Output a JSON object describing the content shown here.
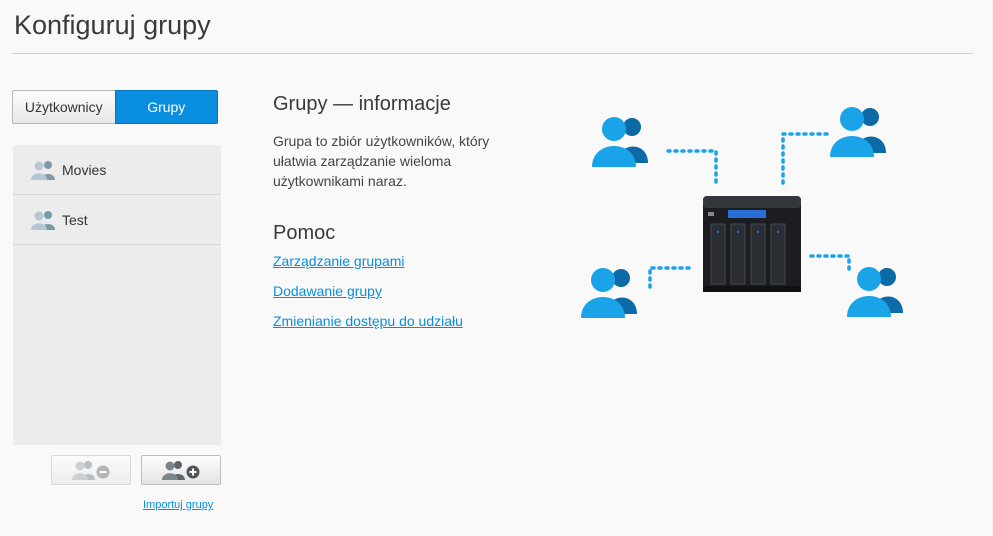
{
  "page": {
    "title": "Konfiguruj grupy"
  },
  "tabs": {
    "users_label": "Użytkownicy",
    "groups_label": "Grupy",
    "active": "Grupy"
  },
  "groups": [
    {
      "name": "Movies"
    },
    {
      "name": "Test"
    }
  ],
  "actions": {
    "import_label": "Importuj grupy"
  },
  "info": {
    "title": "Grupy — informacje",
    "description": "Grupa to zbiór użytkowników, który ułatwia zarządzanie wieloma użytkownikami naraz."
  },
  "help": {
    "title": "Pomoc",
    "links": [
      "Zarządzanie grupami",
      "Dodawanie grupy",
      "Zmienianie dostępu do udziału"
    ]
  },
  "colors": {
    "accent": "#0a8ee0",
    "illustration_light": "#1aa3e8",
    "illustration_dark": "#0c6aa6"
  },
  "icons": {
    "group": "group-icon",
    "remove_group": "group-remove-icon",
    "add_group": "group-add-icon",
    "device": "nas-device-icon"
  }
}
